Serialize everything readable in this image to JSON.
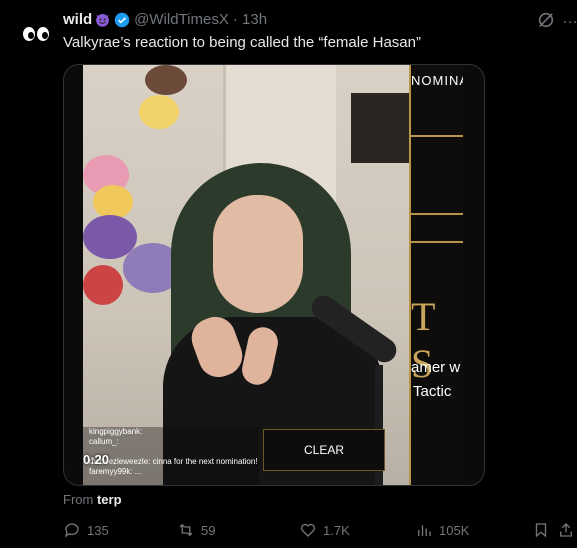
{
  "tweet": {
    "display_name": "wild",
    "handle": "@WildTimesX",
    "time": "· 13h",
    "text": "Valkyrae’s reaction to being called the “female Hasan”",
    "more": "…"
  },
  "video": {
    "overlay_title": "NOMINA",
    "overlay_big": "T S",
    "overlay_line1": "amer w",
    "overlay_line2": "Tactic",
    "clear_button": "CLEAR",
    "timestamp": "0:20",
    "chat": [
      "kingpiggybank:",
      "callum_:",
      "",
      "mcbeezleweezle: cinna for the next nomination!",
      "faremyy99k: ..."
    ]
  },
  "source": {
    "prefix": "From",
    "name": "terp"
  },
  "actions": {
    "replies": "135",
    "reposts": "59",
    "likes": "1.7K",
    "views": "105K"
  },
  "colors": {
    "background": "#000000",
    "text": "#e7e9ea",
    "muted": "#71767b",
    "verified": "#1d9bf0",
    "accent_gold": "#b8954a"
  }
}
